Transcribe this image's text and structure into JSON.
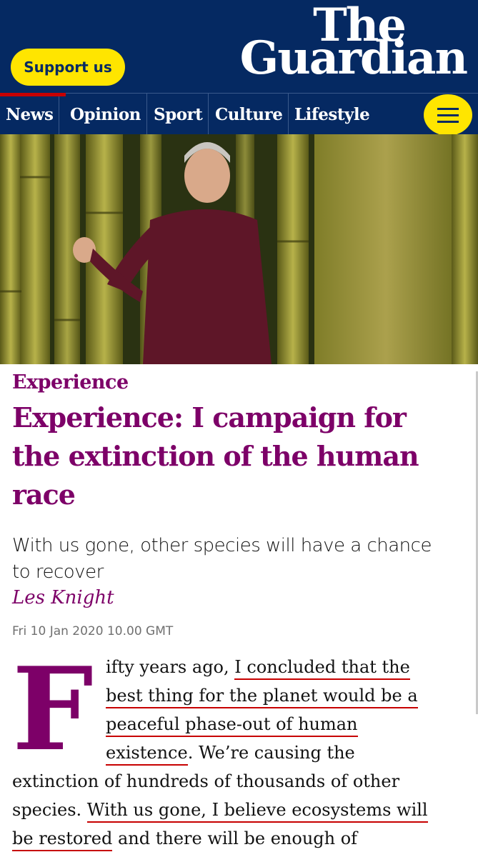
{
  "header": {
    "support_label": "Support us",
    "logo_line1": "The",
    "logo_line2": "Guardian",
    "nav": [
      "News",
      "Opinion",
      "Sport",
      "Culture",
      "Lifestyle"
    ],
    "colors": {
      "brand_blue": "#052962",
      "accent_yellow": "#ffe500",
      "accent_red": "#c70000"
    },
    "menu_icon": "hamburger-icon"
  },
  "article": {
    "kicker": "Experience",
    "headline_lines": [
      "Experience: I campaign for",
      "the extinction of the human",
      "race"
    ],
    "standfirst_lines": [
      "With us gone, other species will have a chance",
      "to recover"
    ],
    "byline": "Les Knight",
    "date": "Fri 10 Jan 2020 10.00 GMT",
    "dropcap": "F",
    "body": {
      "l1a": "ifty years ago, ",
      "l1b": "I concluded that the",
      "l2": "best thing for the planet would be a",
      "l3": "peaceful phase-out of human",
      "l4a": "existence",
      "l4b": ". We’re causing the",
      "l5": "extinction of hundreds of thousands of other",
      "l6a": "species. ",
      "l6b": "With us gone, I believe ecosystems will",
      "l7a": "be restored",
      "l7b": " and there will be enough of"
    },
    "colors": {
      "pillar": "#7d0068"
    }
  }
}
